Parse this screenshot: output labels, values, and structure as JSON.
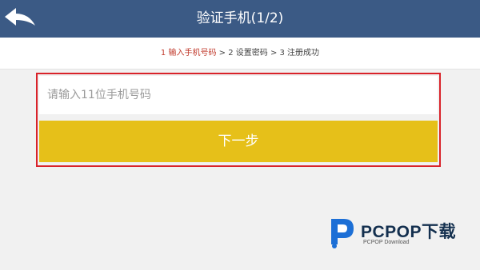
{
  "header": {
    "title": "验证手机(1/2)",
    "back_icon": "back-arrow-icon"
  },
  "steps": {
    "step1": "1 输入手机号码",
    "sep1": " > ",
    "step2": "2 设置密码",
    "sep2": " > ",
    "step3": "3 注册成功"
  },
  "form": {
    "phone_placeholder": "请输入11位手机号码",
    "phone_value": "",
    "next_label": "下一步"
  },
  "watermark": {
    "brand": "PCPOP下载",
    "sub": "PCPOP Download"
  },
  "colors": {
    "header_bg": "#3b5a85",
    "active_step": "#c0392b",
    "next_button": "#e6c019",
    "highlight_border": "#d9232a"
  }
}
